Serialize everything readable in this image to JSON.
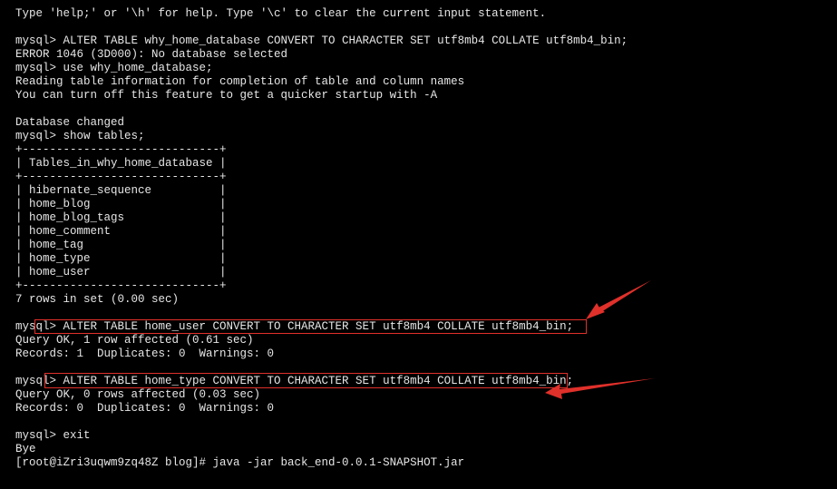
{
  "terminal": {
    "lines": [
      "Type 'help;' or '\\h' for help. Type '\\c' to clear the current input statement.",
      "",
      "mysql> ALTER TABLE why_home_database CONVERT TO CHARACTER SET utf8mb4 COLLATE utf8mb4_bin;",
      "ERROR 1046 (3D000): No database selected",
      "mysql> use why_home_database;",
      "Reading table information for completion of table and column names",
      "You can turn off this feature to get a quicker startup with -A",
      "",
      "Database changed",
      "mysql> show tables;",
      "+-----------------------------+",
      "| Tables_in_why_home_database |",
      "+-----------------------------+",
      "| hibernate_sequence          |",
      "| home_blog                   |",
      "| home_blog_tags              |",
      "| home_comment                |",
      "| home_tag                    |",
      "| home_type                   |",
      "| home_user                   |",
      "+-----------------------------+",
      "7 rows in set (0.00 sec)",
      "",
      "mysql> ALTER TABLE home_user CONVERT TO CHARACTER SET utf8mb4 COLLATE utf8mb4_bin;",
      "Query OK, 1 row affected (0.61 sec)",
      "Records: 1  Duplicates: 0  Warnings: 0",
      "",
      "mysql> ALTER TABLE home_type CONVERT TO CHARACTER SET utf8mb4 COLLATE utf8mb4_bin;",
      "Query OK, 0 rows affected (0.03 sec)",
      "Records: 0  Duplicates: 0  Warnings: 0",
      "",
      "mysql> exit",
      "Bye",
      "[root@iZri3uqwm9zq48Z blog]# java -jar back_end-0.0.1-SNAPSHOT.jar"
    ]
  },
  "colors": {
    "background": "#000000",
    "text": "#e6e6e6",
    "annotation": "#e0302a"
  }
}
